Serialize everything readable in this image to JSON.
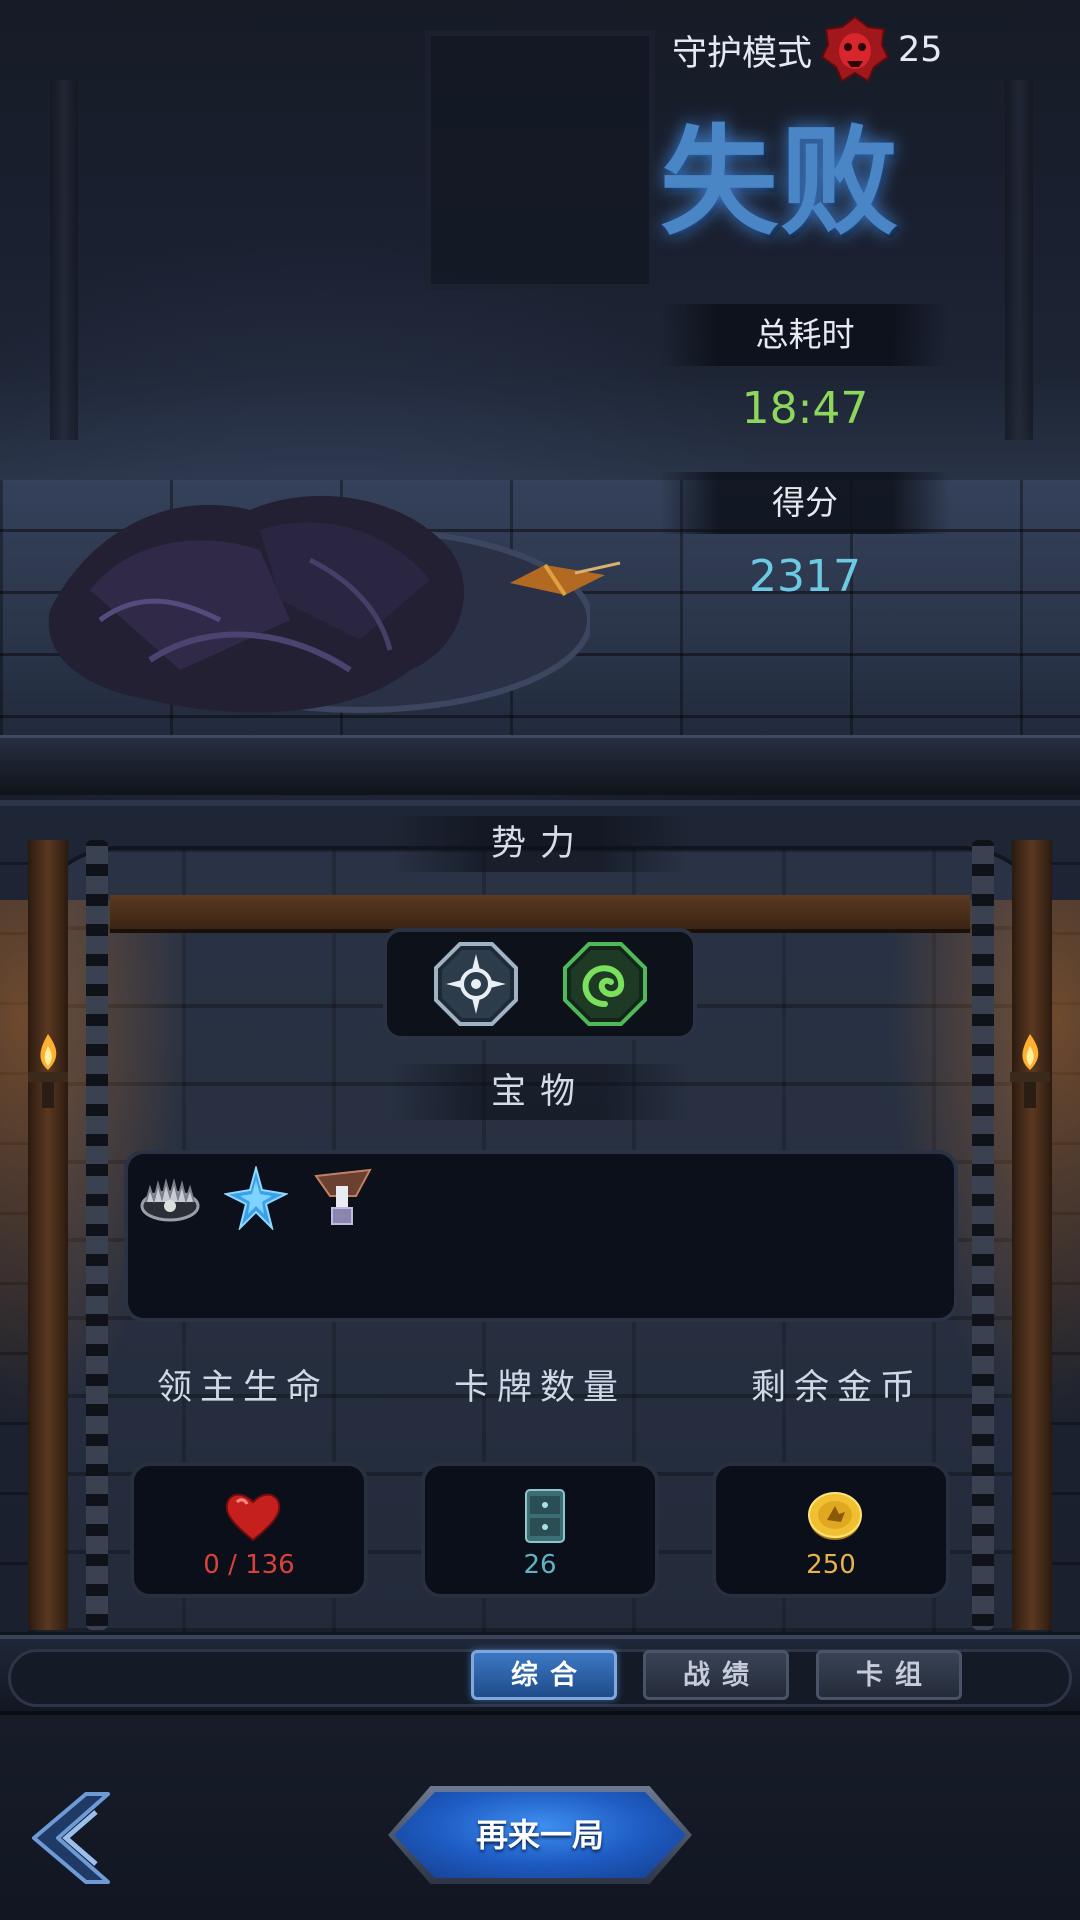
{
  "header": {
    "mode_label": "守护模式",
    "difficulty_icon": "red-demon-skull-icon",
    "difficulty_value": "25"
  },
  "result": {
    "title": "失败",
    "total_time_label": "总耗时",
    "total_time_value": "18:47",
    "score_label": "得分",
    "score_value": "2317"
  },
  "factions": {
    "title": "势力",
    "items": [
      {
        "icon": "compass-star-faction-icon"
      },
      {
        "icon": "green-spiral-faction-icon"
      }
    ]
  },
  "treasures": {
    "title": "宝物",
    "items": [
      {
        "icon": "bear-trap-icon"
      },
      {
        "icon": "blue-crystal-star-icon"
      },
      {
        "icon": "hammer-anvil-icon"
      }
    ]
  },
  "stats": {
    "lord_hp": {
      "label": "领主生命",
      "value": "0 / 136",
      "icon": "heart-icon",
      "color": "#d8423a"
    },
    "card_count": {
      "label": "卡牌数量",
      "value": "26",
      "icon": "card-deck-icon",
      "color": "#5fb3c4"
    },
    "gold_left": {
      "label": "剩余金币",
      "value": "250",
      "icon": "gold-coin-icon",
      "color": "#e7b24c"
    }
  },
  "tabs": [
    {
      "label": "综合",
      "active": true
    },
    {
      "label": "战绩",
      "active": false
    },
    {
      "label": "卡组",
      "active": false
    }
  ],
  "footer": {
    "back_icon": "back-arrow-icon",
    "replay_label": "再来一局"
  },
  "colors": {
    "accent_blue": "#3c78c4",
    "time_green": "#8fd65c",
    "score_cyan": "#6cc9e3"
  }
}
